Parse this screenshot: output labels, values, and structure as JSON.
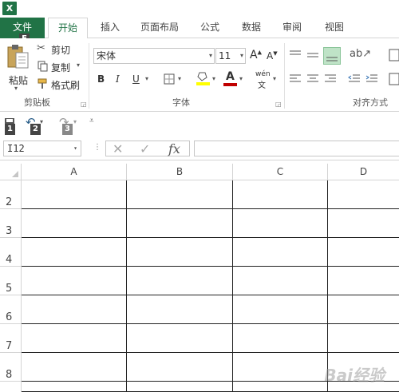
{
  "app": {
    "icon_letter": "X"
  },
  "tabs": [
    {
      "label": "文件"
    },
    {
      "label": "开始"
    },
    {
      "label": "插入"
    },
    {
      "label": "页面布局"
    },
    {
      "label": "公式"
    },
    {
      "label": "数据"
    },
    {
      "label": "审阅"
    },
    {
      "label": "视图"
    }
  ],
  "keytips": {
    "file": "F",
    "qat1": "1",
    "qat2": "2",
    "qat3": "3"
  },
  "clipboard": {
    "paste_label": "粘贴",
    "cut_label": "剪切",
    "copy_label": "复制",
    "format_painter_label": "格式刷",
    "group_label": "剪贴板"
  },
  "font": {
    "name": "宋体",
    "size": "11",
    "grow": "A",
    "shrink": "A",
    "bold": "B",
    "italic": "I",
    "underline": "U",
    "font_color_glyph": "A",
    "phonetic": "wén",
    "group_label": "字体"
  },
  "alignment": {
    "group_label": "对齐方式"
  },
  "namebox": {
    "value": "I12"
  },
  "formula_bar": {
    "cancel": "✕",
    "enter": "✓",
    "fx": "fx"
  },
  "columns": [
    "A",
    "B",
    "C",
    "D"
  ],
  "rows": [
    "2",
    "3",
    "4",
    "5",
    "6",
    "7",
    "8"
  ],
  "watermark": "Bai经验",
  "colors": {
    "excel_green": "#217346",
    "highlight_yellow": "#ffff00",
    "font_red": "#c00000"
  }
}
